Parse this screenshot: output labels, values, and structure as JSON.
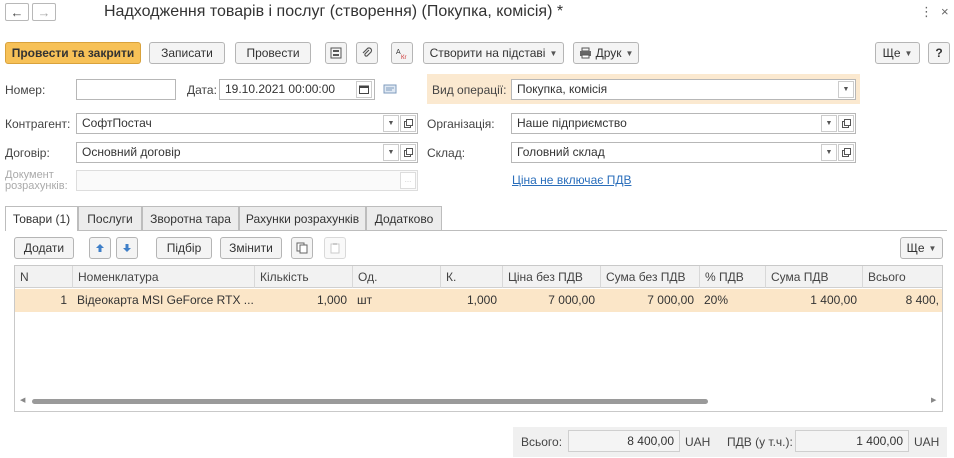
{
  "window": {
    "title": "Надходження товарів і послуг (створення) (Покупка, комісія) *",
    "more_glyph": "⋮",
    "close_glyph": "×",
    "back_glyph": "←",
    "forward_glyph": "→"
  },
  "toolbar": {
    "post_and_close": "Провести та закрити",
    "save": "Записати",
    "post": "Провести",
    "create_based_on": "Створити на підставі",
    "print": "Друк",
    "more": "Ще",
    "help": "?"
  },
  "form": {
    "number_label": "Номер:",
    "number_value": "",
    "date_label": "Дата:",
    "date_value": "19.10.2021 00:00:00",
    "operation_label": "Вид операції:",
    "operation_value": "Покупка, комісія",
    "counterparty_label": "Контрагент:",
    "counterparty_value": "СофтПостач",
    "organization_label": "Організація:",
    "organization_value": "Наше підприємство",
    "contract_label": "Договір:",
    "contract_value": "Основний договір",
    "warehouse_label": "Склад:",
    "warehouse_value": "Головний склад",
    "settlement_doc_label_1": "Документ",
    "settlement_doc_label_2": "розрахунків:",
    "settlement_doc_value": "",
    "vat_link": "Ціна не включає ПДВ"
  },
  "tabs": [
    {
      "label": "Товари (1)",
      "active": true
    },
    {
      "label": "Послуги",
      "active": false
    },
    {
      "label": "Зворотна тара",
      "active": false
    },
    {
      "label": "Рахунки розрахунків",
      "active": false
    },
    {
      "label": "Додатково",
      "active": false
    }
  ],
  "table_toolbar": {
    "add": "Додати",
    "pick": "Підбір",
    "change": "Змінити",
    "more": "Ще"
  },
  "table": {
    "columns": [
      "N",
      "Номенклатура",
      "Кількість",
      "Од.",
      "К.",
      "Ціна без ПДВ",
      "Сума без ПДВ",
      "% ПДВ",
      "Сума ПДВ",
      "Всього"
    ],
    "rows": [
      [
        "1",
        "Відеокарта MSI GeForce RTX ...",
        "1,000",
        "шт",
        "1,000",
        "7 000,00",
        "7 000,00",
        "20%",
        "1 400,00",
        "8 400,"
      ]
    ]
  },
  "footer": {
    "total_label": "Всього:",
    "total_value": "8 400,00",
    "total_currency": "UAH",
    "vat_label": "ПДВ (у т.ч.):",
    "vat_value": "1 400,00",
    "vat_currency": "UAH"
  },
  "colors": {
    "primary_button": "#f7c157",
    "selected_row": "#fbe6c8",
    "operation_highlight": "#fbe9d0",
    "link": "#2a6ebb"
  }
}
